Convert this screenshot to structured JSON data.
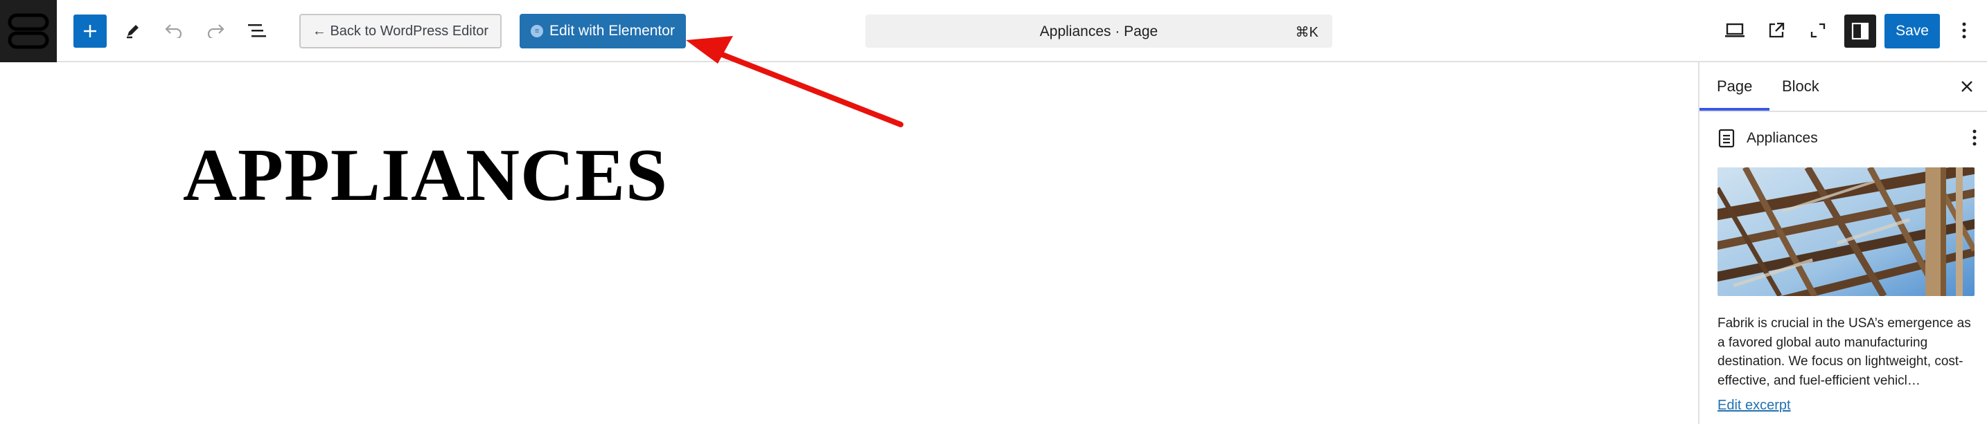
{
  "toolbar": {
    "logo_icon": "site-logo-icon",
    "add_icon": "plus-icon",
    "tools_icon": "pencil-icon",
    "undo_icon": "undo-icon",
    "redo_icon": "redo-icon",
    "outline_icon": "document-overview-icon",
    "back_button_label": "← Back to WordPress Editor",
    "elementor_button_label": "Edit with Elementor",
    "elementor_icon": "elementor-icon",
    "command_bar": {
      "title": "Appliances · Page",
      "shortcut": "⌘K"
    },
    "view_icon": "desktop-view-icon",
    "preview_icon": "external-link-icon",
    "fullscreen_icon": "fullscreen-icon",
    "settings_icon": "sidebar-toggle-icon",
    "save_label": "Save",
    "options_icon": "more-vertical-icon"
  },
  "canvas": {
    "page_title": "APPLIANCES"
  },
  "sidebar": {
    "tabs": [
      {
        "label": "Page",
        "active": true
      },
      {
        "label": "Block",
        "active": false
      }
    ],
    "close_icon": "close-icon",
    "document": {
      "icon": "page-icon",
      "title": "Appliances",
      "options_icon": "more-vertical-icon"
    },
    "featured_image_alt": "featured-image-steel-structure",
    "excerpt": "Fabrik is crucial in the USA’s emergence as a favored global auto manufacturing destination. We focus on lightweight, cost-effective, and fuel-efficient vehicl…",
    "edit_excerpt_label": "Edit excerpt"
  },
  "annotation": {
    "arrow_color": "#e8120c",
    "arrow_target": "elementor-button"
  },
  "colors": {
    "wp_blue": "#0a6ec2",
    "elementor_button": "#2271b1",
    "tab_indicator": "#3858e9",
    "dark": "#1e1e1e"
  }
}
